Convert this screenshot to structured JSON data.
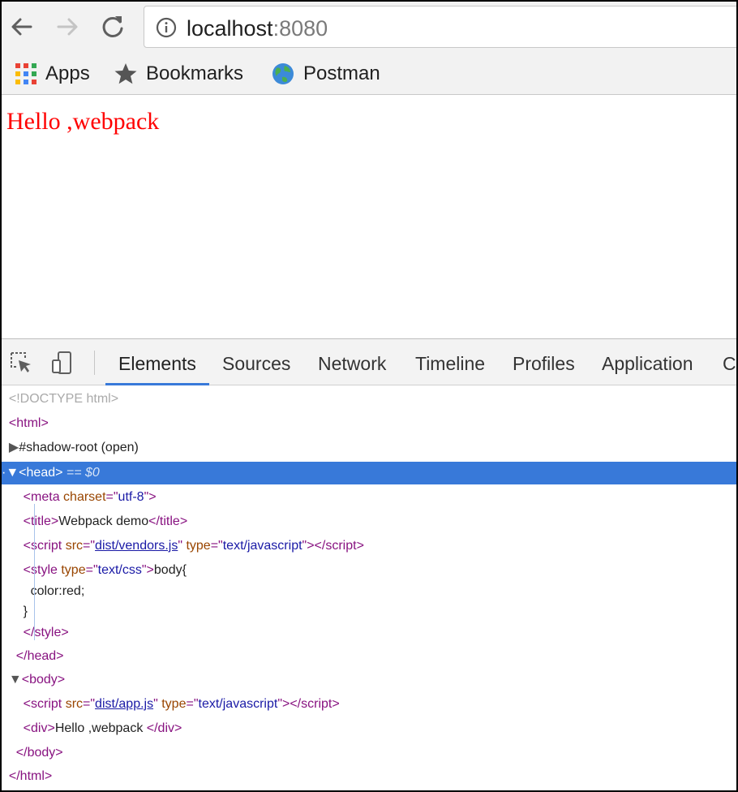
{
  "toolbar": {
    "back_icon": "arrow-left-icon",
    "forward_icon": "arrow-right-icon",
    "reload_icon": "reload-icon",
    "url_host": "localhost",
    "url_port": ":8080"
  },
  "bookmarks": {
    "items": [
      {
        "icon": "apps-grid-icon",
        "label": "Apps"
      },
      {
        "icon": "star-icon",
        "label": "Bookmarks"
      },
      {
        "icon": "globe-icon",
        "label": "Postman"
      }
    ]
  },
  "page": {
    "text": "Hello ,webpack",
    "text_color": "#ff0000"
  },
  "devtools": {
    "tabs": [
      "Elements",
      "Sources",
      "Network",
      "Timeline",
      "Profiles",
      "Application",
      "C"
    ],
    "active_tab": "Elements",
    "accent_color": "#3879d9",
    "tree": {
      "doctype": "<!DOCTYPE html>",
      "html_open": "<html>",
      "shadow_root": "#shadow-root (open)",
      "head_open": "<head>",
      "head_eq": " == $0",
      "meta_tag": "meta",
      "meta_attr": "charset",
      "meta_val": "utf-8",
      "title_open": "<title>",
      "title_text": "Webpack demo",
      "title_close": "</title>",
      "script1_src": "dist/vendors.js",
      "script_type": "text/javascript",
      "style_type": "text/css",
      "style_line1": "body{",
      "style_line2": "color:red;",
      "style_line3": "}",
      "style_close": "</style>",
      "head_close": "</head>",
      "body_open": "<body>",
      "script2_src": "dist/app.js",
      "div_text": "Hello ,webpack ",
      "body_close": "</body>",
      "html_close": "</html>"
    }
  }
}
